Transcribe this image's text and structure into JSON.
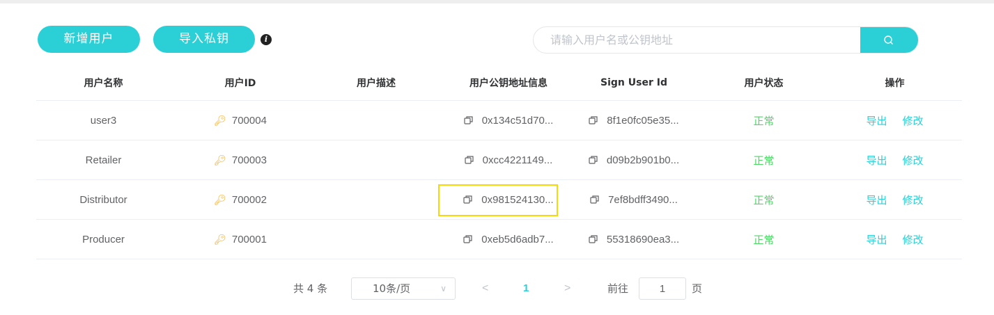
{
  "toolbar": {
    "add_user_label": "新增用户",
    "import_key_label": "导入私钥",
    "info_glyph": "i"
  },
  "search": {
    "placeholder": "请输入用户名或公钥地址",
    "icon": "search-icon"
  },
  "table": {
    "headers": {
      "name": "用户名称",
      "id": "用户ID",
      "desc": "用户描述",
      "pub": "用户公钥地址信息",
      "sign": "Sign User Id",
      "status": "用户状态",
      "op": "操作"
    },
    "rows": [
      {
        "name": "user3",
        "id": "700004",
        "desc": "",
        "pub": "0x134c51d70...",
        "sign": "8f1e0fc05e35...",
        "status": "正常",
        "export": "导出",
        "edit": "修改"
      },
      {
        "name": "Retailer",
        "id": "700003",
        "desc": "",
        "pub": "0xcc4221149...",
        "sign": "d09b2b901b0...",
        "status": "正常",
        "export": "导出",
        "edit": "修改"
      },
      {
        "name": "Distributor",
        "id": "700002",
        "desc": "",
        "pub": "0x981524130...",
        "sign": "7ef8bdff3490...",
        "status": "正常",
        "export": "导出",
        "edit": "修改"
      },
      {
        "name": "Producer",
        "id": "700001",
        "desc": "",
        "pub": "0xeb5d6adb7...",
        "sign": "55318690ea3...",
        "status": "正常",
        "export": "导出",
        "edit": "修改"
      }
    ]
  },
  "pagination": {
    "total": "共 4 条",
    "page_size": "10条/页",
    "prev": "<",
    "current_page": "1",
    "next": ">",
    "goto_label": "前往",
    "goto_value": "1",
    "page_suffix": "页"
  },
  "colors": {
    "accent": "#2bd0d6",
    "status_ok": "#4cd964",
    "key": "#f5a623",
    "highlight": "#f5d90a"
  }
}
